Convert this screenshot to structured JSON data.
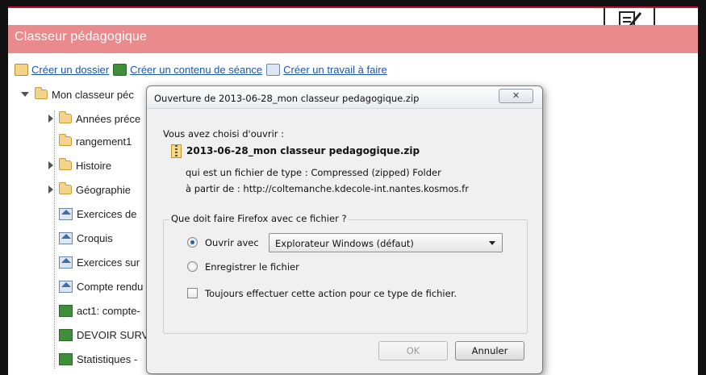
{
  "page": {
    "title": "Classeur pédagogique"
  },
  "toolbar": {
    "links": [
      {
        "label": "Créer un dossier",
        "icon": "new-folder-icon"
      },
      {
        "label": "Créer un contenu de séance",
        "icon": "session-content-icon"
      },
      {
        "label": "Créer un travail à faire",
        "icon": "homework-icon"
      }
    ]
  },
  "tree": {
    "root": "Mon classeur péc",
    "items": [
      {
        "label": "Années préce",
        "type": "folder",
        "expandable": true
      },
      {
        "label": "rangement1",
        "type": "folder",
        "expandable": false
      },
      {
        "label": "Histoire",
        "type": "folder",
        "expandable": true
      },
      {
        "label": "Géographie",
        "type": "folder",
        "expandable": true
      },
      {
        "label": "Exercices de",
        "type": "homework"
      },
      {
        "label": "Croquis",
        "type": "homework"
      },
      {
        "label": "Exercices sur",
        "type": "homework"
      },
      {
        "label": "Compte rendu",
        "type": "homework"
      },
      {
        "label": "act1: compte-",
        "type": "session"
      },
      {
        "label": "DEVOIR SURV",
        "type": "session"
      },
      {
        "label": "Statistiques -",
        "type": "session"
      }
    ]
  },
  "dialog": {
    "title": "Ouverture de 2013-06-28_mon classeur pedagogique.zip",
    "close_label": "✕",
    "intro": "Vous avez choisi d'ouvrir :",
    "filename": "2013-06-28_mon classeur pedagogique.zip",
    "type_line": "qui est un fichier de type :  Compressed (zipped) Folder",
    "from_line": "à partir de :  http://coltemanche.kdecole-int.nantes.kosmos.fr",
    "question": "Que doit faire Firefox avec ce fichier ?",
    "open_with_label": "Ouvrir avec",
    "open_with_value": "Explorateur Windows (défaut)",
    "save_label": "Enregistrer le fichier",
    "always_label": "Toujours effectuer cette action pour ce type de fichier.",
    "ok_label": "OK",
    "cancel_label": "Annuler",
    "selected_option": "open_with",
    "always_checked": false
  }
}
